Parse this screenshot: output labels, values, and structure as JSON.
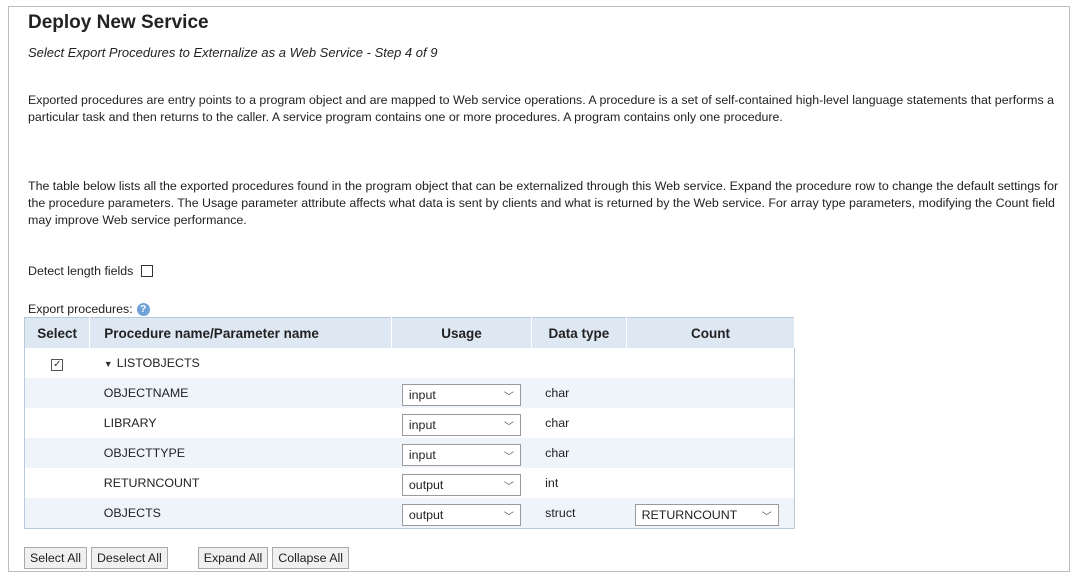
{
  "page": {
    "title": "Deploy New Service",
    "subtitle": "Select Export Procedures to Externalize as a Web Service - Step 4 of 9",
    "paragraph1": "Exported procedures are entry points to a program object and are mapped to Web service operations. A procedure is a set of self-contained high-level language statements that performs a particular task and then returns to the caller. A service program contains one or more procedures. A program contains only one procedure.",
    "paragraph2": "The table below lists all the exported procedures found in the program object that can be externalized through this Web service. Expand the procedure row to change the default settings for the procedure parameters. The Usage parameter attribute affects what data is sent by clients and what is returned by the Web service. For array type parameters, modifying the Count field may improve Web service performance."
  },
  "options": {
    "detect_label": "Detect length fields",
    "detect_checked": false,
    "export_label": "Export procedures:",
    "help_icon": "help-circle-icon"
  },
  "table": {
    "headers": {
      "select": "Select",
      "name": "Procedure name/Parameter name",
      "usage": "Usage",
      "type": "Data type",
      "count": "Count"
    },
    "procedure": {
      "name": "LISTOBJECTS",
      "checked": true,
      "expanded": true
    },
    "params": [
      {
        "name": "OBJECTNAME",
        "usage": "input",
        "type": "char",
        "count": ""
      },
      {
        "name": "LIBRARY",
        "usage": "input",
        "type": "char",
        "count": ""
      },
      {
        "name": "OBJECTTYPE",
        "usage": "input",
        "type": "char",
        "count": ""
      },
      {
        "name": "RETURNCOUNT",
        "usage": "output",
        "type": "int",
        "count": ""
      },
      {
        "name": "OBJECTS",
        "usage": "output",
        "type": "struct",
        "count": "RETURNCOUNT"
      }
    ]
  },
  "buttons": {
    "select_all": "Select All",
    "deselect_all": "Deselect All",
    "expand_all": "Expand All",
    "collapse_all": "Collapse All"
  }
}
